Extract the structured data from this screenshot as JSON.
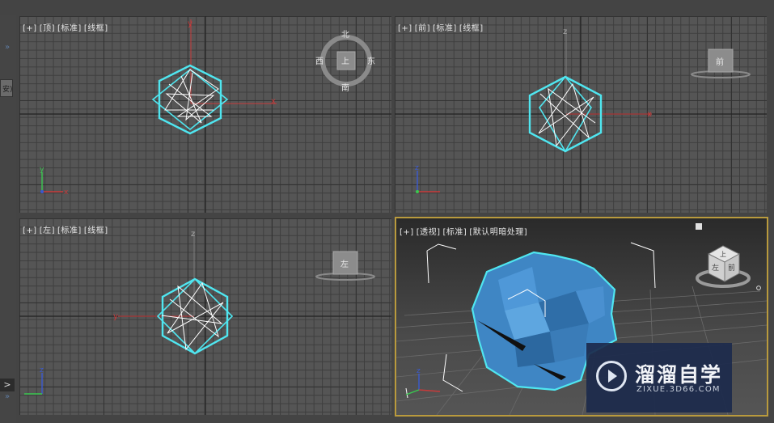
{
  "left_panel": {
    "button_label": "安)",
    "expand_arrow": ">",
    "chevron_top": "»",
    "chevron_bottom": "»"
  },
  "viewports": [
    {
      "id": "top",
      "plus": "[+]",
      "view": "[顶]",
      "shading_mode": "[标准]",
      "style": "[线框]",
      "viewcube": {
        "type": "compass",
        "center": "上",
        "n": "北",
        "s": "南",
        "e": "东",
        "w": "西"
      }
    },
    {
      "id": "front",
      "plus": "[+]",
      "view": "[前]",
      "shading_mode": "[标准]",
      "style": "[线框]",
      "viewcube": {
        "type": "face",
        "face": "前"
      }
    },
    {
      "id": "left",
      "plus": "[+]",
      "view": "[左]",
      "shading_mode": "[标准]",
      "style": "[线框]",
      "viewcube": {
        "type": "face",
        "face": "左"
      }
    },
    {
      "id": "perspective",
      "plus": "[+]",
      "view": "[透视]",
      "shading_mode": "[标准]",
      "style": "[默认明暗处理]",
      "viewcube": {
        "type": "cube",
        "face_left": "左",
        "face_front": "前",
        "face_top": "上"
      },
      "active": true
    }
  ],
  "axis_labels": {
    "x": "x",
    "y": "y",
    "z": "z"
  },
  "watermark": {
    "title": "溜溜自学",
    "url": "ZIXUE.3D66.COM"
  },
  "colors": {
    "viewport_bg": "#555555",
    "object_highlight": "#4fe6f0",
    "wire_white": "#ffffff",
    "axis_red": "#c83a3a",
    "axis_green": "#3ac850",
    "axis_blue": "#3a5ad0",
    "active_border": "#b99a3d",
    "object_fill": "#3f86c4"
  }
}
